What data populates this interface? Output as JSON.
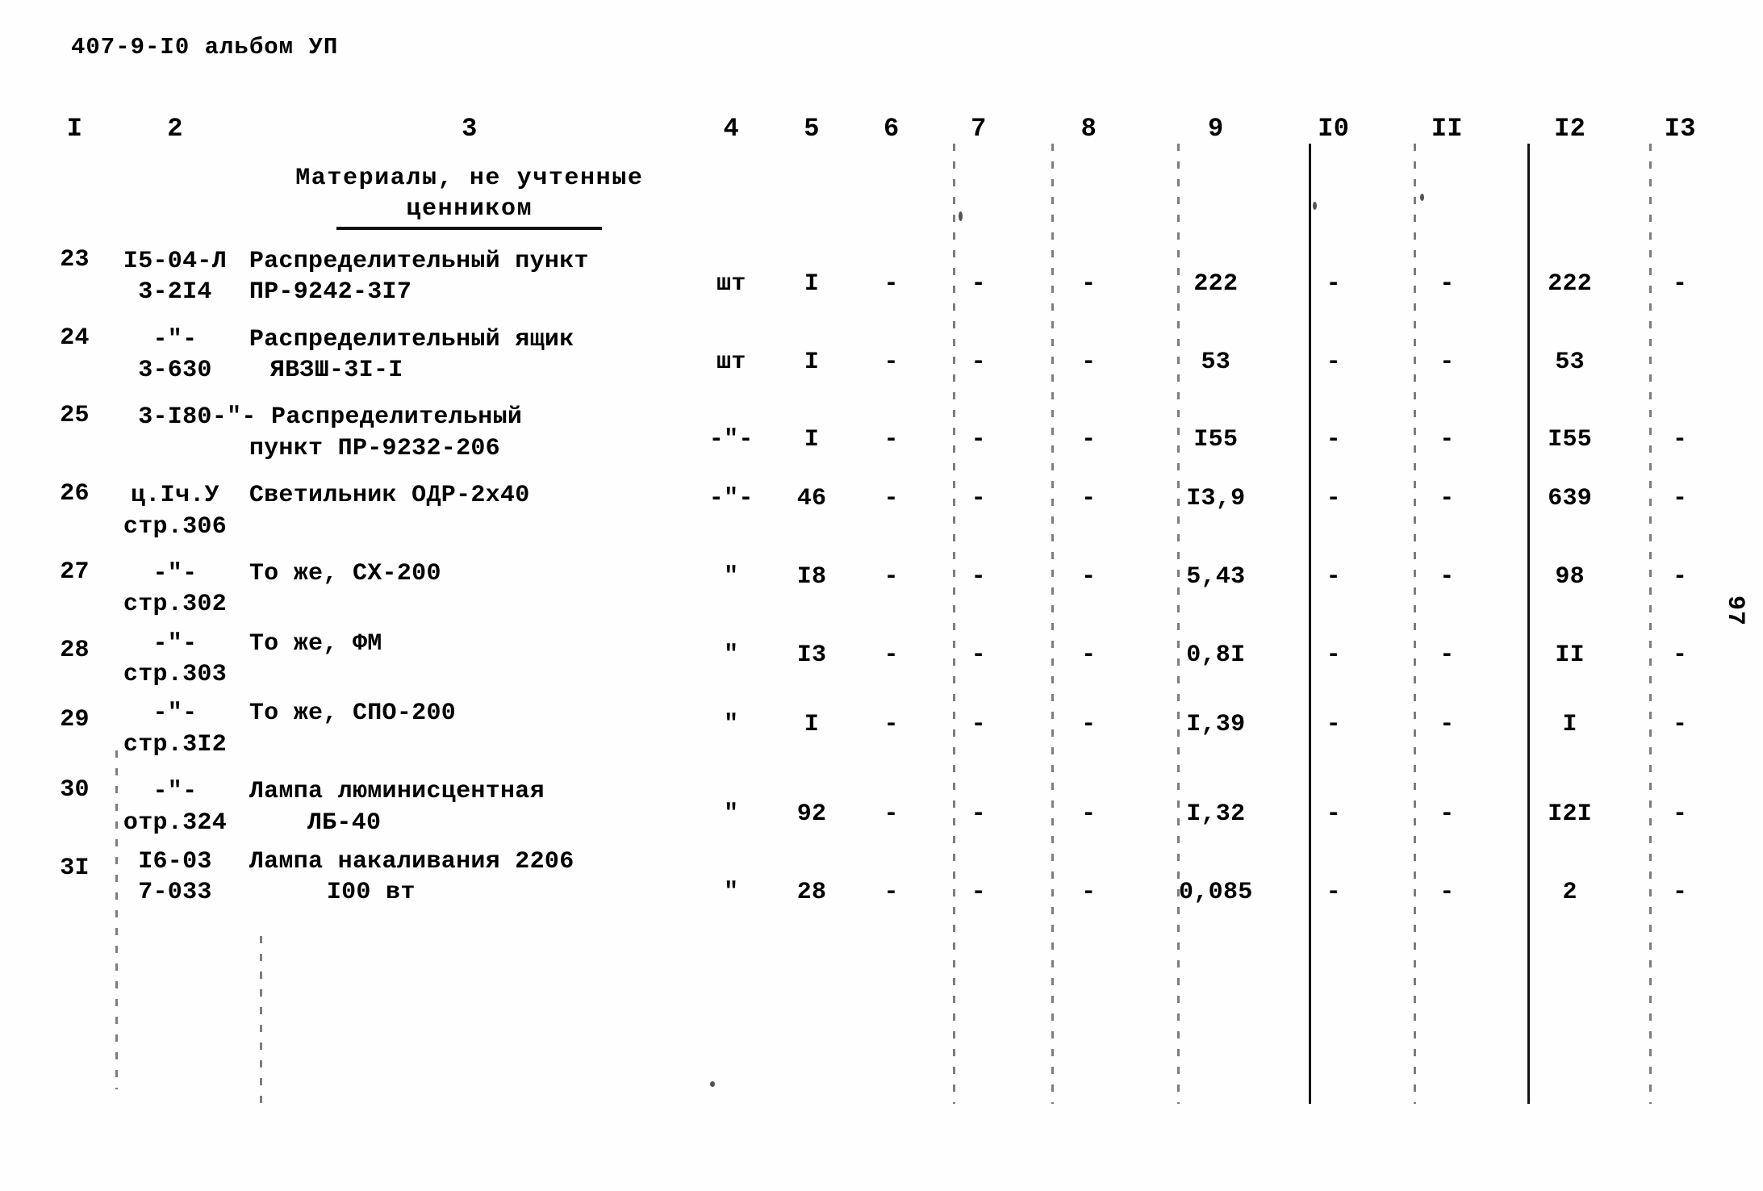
{
  "document": {
    "header": "407-9-I0 альбом УП",
    "page_number": "97"
  },
  "table": {
    "column_headers": [
      "I",
      "2",
      "3",
      "4",
      "5",
      "6",
      "7",
      "8",
      "9",
      "I0",
      "II",
      "I2",
      "I3"
    ],
    "section_title": {
      "line1": "Материалы, не учтенные",
      "line2": "ценником"
    },
    "rows": [
      {
        "num": "23",
        "code_top": "I5-04-Л",
        "code_bottom": "3-2I4",
        "name_top": "Распределительный пункт",
        "name_bottom": "ПР-9242-3I7",
        "unit": "шт",
        "qty": "I",
        "c6": "-",
        "c7": "-",
        "c8": "-",
        "c9": "222",
        "c10": "-",
        "c11": "-",
        "c12": "222",
        "c13": "-"
      },
      {
        "num": "24",
        "code_top": "-\"-",
        "code_bottom": "3-630",
        "name_top": "Распределительный ящик",
        "name_bottom": "ЯВЗШ-3I-I",
        "unit": "шт",
        "qty": "I",
        "c6": "-",
        "c7": "-",
        "c8": "-",
        "c9": "53",
        "c10": "-",
        "c11": "-",
        "c12": "53",
        "c13": ""
      },
      {
        "num": "25",
        "code_top": "",
        "code_bottom": "3-I80",
        "name_top": "-\"- Распределительный",
        "name_bottom": "пункт ПР-9232-206",
        "unit": "-\"-",
        "qty": "I",
        "c6": "-",
        "c7": "-",
        "c8": "-",
        "c9": "I55",
        "c10": "-",
        "c11": "-",
        "c12": "I55",
        "c13": "-"
      },
      {
        "num": "26",
        "code_top": "ц.Iч.У",
        "code_bottom": "стр.306",
        "name_top": "Светильник ОДР-2х40",
        "name_bottom": "",
        "unit": "-\"-",
        "qty": "46",
        "c6": "-",
        "c7": "-",
        "c8": "-",
        "c9": "I3,9",
        "c10": "-",
        "c11": "-",
        "c12": "639",
        "c13": "-"
      },
      {
        "num": "27",
        "code_top": "-\"-",
        "code_bottom": "стр.302",
        "name_top": "То же, СХ-200",
        "name_bottom": "",
        "unit": "\"",
        "qty": "I8",
        "c6": "-",
        "c7": "-",
        "c8": "-",
        "c9": "5,43",
        "c10": "-",
        "c11": "-",
        "c12": "98",
        "c13": "-"
      },
      {
        "num": "28",
        "code_top": "-\"-",
        "code_bottom": "стр.303",
        "name_top": "То же, ФМ",
        "name_bottom": "",
        "unit": "\"",
        "qty": "I3",
        "c6": "-",
        "c7": "-",
        "c8": "-",
        "c9": "0,8I",
        "c10": "-",
        "c11": "-",
        "c12": "II",
        "c13": "-"
      },
      {
        "num": "29",
        "code_top": "-\"-",
        "code_bottom": "стр.3I2",
        "name_top": "То же, СПО-200",
        "name_bottom": "",
        "unit": "\"",
        "qty": "I",
        "c6": "-",
        "c7": "-",
        "c8": "-",
        "c9": "I,39",
        "c10": "-",
        "c11": "-",
        "c12": "I",
        "c13": "-"
      },
      {
        "num": "30",
        "code_top": "-\"-",
        "code_bottom": "отр.324",
        "name_top": "Лампа люминисцентная",
        "name_bottom": "ЛБ-40",
        "unit": "\"",
        "qty": "92",
        "c6": "-",
        "c7": "-",
        "c8": "-",
        "c9": "I,32",
        "c10": "-",
        "c11": "-",
        "c12": "I2I",
        "c13": "-"
      },
      {
        "num": "3I",
        "code_top": "I6-03",
        "code_bottom": "7-033",
        "name_top": "Лампа накаливания 2206",
        "name_bottom": "I00 вт",
        "unit": "\"",
        "qty": "28",
        "c6": "-",
        "c7": "-",
        "c8": "-",
        "c9": "0,085",
        "c10": "-",
        "c11": "-",
        "c12": "2",
        "c13": "-"
      }
    ]
  }
}
